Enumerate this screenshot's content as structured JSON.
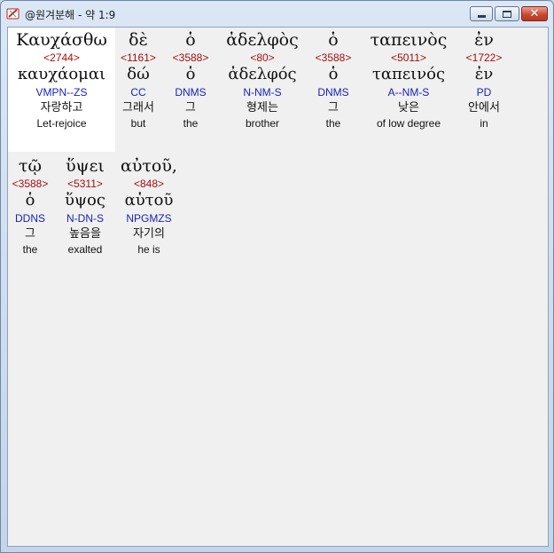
{
  "window": {
    "title": "@원겨분해 - 약 1:9",
    "buttons": {
      "minimize": "minimize",
      "maximize": "maximize",
      "close": "✕"
    }
  },
  "colors": {
    "strong_number": "#a01010",
    "morphology": "#1a22b8",
    "selection_background": "#ffffff",
    "client_background": "#f0f0f0"
  },
  "words": [
    {
      "greek": "Καυχάσθω",
      "strong": "<2744>",
      "lemma": "καυχάομαι",
      "morph": "VMPN--ZS",
      "korean": "자랑하고",
      "english": "Let-rejoice"
    },
    {
      "greek": "δὲ",
      "strong": "<1161>",
      "lemma": "δώ",
      "morph": "CC",
      "korean": "그래서",
      "english": "but"
    },
    {
      "greek": "ὁ",
      "strong": "<3588>",
      "lemma": "ὁ",
      "morph": "DNMS",
      "korean": "그",
      "english": "the"
    },
    {
      "greek": "ἀδελφὸς",
      "strong": "<80>",
      "lemma": "ἀδελφός",
      "morph": "N-NM-S",
      "korean": "형제는",
      "english": "brother"
    },
    {
      "greek": "ὁ",
      "strong": "<3588>",
      "lemma": "ὁ",
      "morph": "DNMS",
      "korean": "그",
      "english": "the"
    },
    {
      "greek": "ταπεινὸς",
      "strong": "<5011>",
      "lemma": "ταπεινός",
      "morph": "A--NM-S",
      "korean": "낮은",
      "english": "of low degree"
    },
    {
      "greek": "ἐν",
      "strong": "<1722>",
      "lemma": "ἐν",
      "morph": "PD",
      "korean": "안에서",
      "english": "in"
    },
    {
      "greek": "τῷ",
      "strong": "<3588>",
      "lemma": "ὁ",
      "morph": "DDNS",
      "korean": "그",
      "english": "the"
    },
    {
      "greek": "ὕψει",
      "strong": "<5311>",
      "lemma": "ὕψος",
      "morph": "N-DN-S",
      "korean": "높음을",
      "english": "exalted"
    },
    {
      "greek": "αὐτοῦ,",
      "strong": "<848>",
      "lemma": "αὑτοῦ",
      "morph": "NPGMZS",
      "korean": "자기의",
      "english": "he is"
    }
  ]
}
